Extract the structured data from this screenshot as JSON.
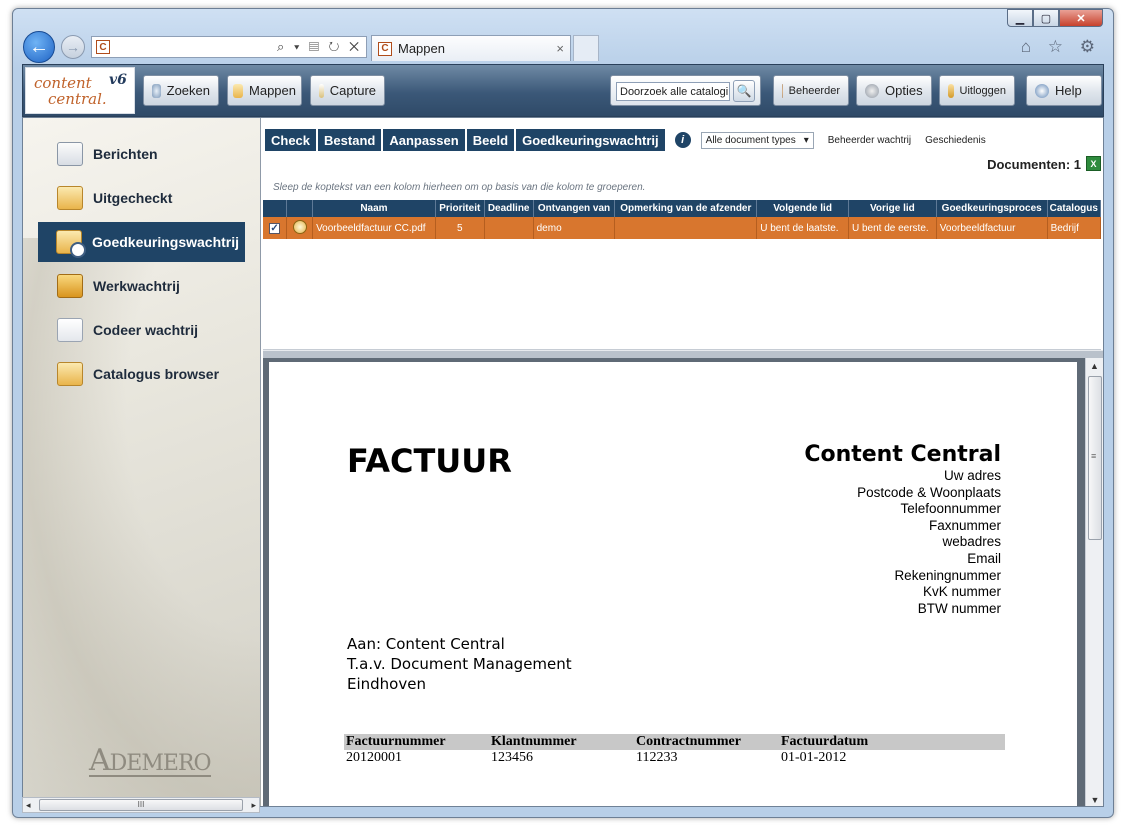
{
  "browser": {
    "address_text": "",
    "tab_title": "Mappen",
    "tab_close": "×",
    "address_icons": "⌕ ▾ ▤ ↻ ✕",
    "toolbar_icons": "⌂ ☆ ⚙",
    "favicon": "C",
    "caption": {
      "minimize": "▁",
      "maximize": "▢",
      "close": "✕"
    },
    "back_glyph": "←",
    "forward_glyph": "→"
  },
  "app": {
    "logo_line1": "content",
    "logo_line2": "central.",
    "logo_version": "v6",
    "buttons": {
      "zoeken": "Zoeken",
      "mappen": "Mappen",
      "capture": "Capture",
      "beheerder": "Beheerder",
      "opties": "Opties",
      "uitloggen": "Uitloggen",
      "help": "Help"
    },
    "search_value": "Doorzoek alle catalogi",
    "search_go": "🔍"
  },
  "sidebar": {
    "items": [
      {
        "label": "Berichten",
        "icon": "envelope-icon"
      },
      {
        "label": "Uitgecheckt",
        "icon": "folder-out-icon"
      },
      {
        "label": "Goedkeuringswachtrij",
        "icon": "approval-queue-icon",
        "active": true
      },
      {
        "label": "Werkwachtrij",
        "icon": "briefcase-icon"
      },
      {
        "label": "Codeer wachtrij",
        "icon": "edit-document-icon"
      },
      {
        "label": "Catalogus browser",
        "icon": "catalog-icon"
      }
    ],
    "brand": "ADEMERO",
    "brand_a": "A",
    "brand_rest": "DEMERO"
  },
  "menubar": {
    "tabs": [
      "Check",
      "Bestand",
      "Aanpassen",
      "Beeld",
      "Goedkeuringswachtrij"
    ],
    "info_glyph": "i",
    "doc_types": "Alle document types",
    "doc_types_arrow": "▾",
    "links": [
      "Beheerder wachtrij",
      "Geschiedenis"
    ]
  },
  "documents_count": "Documenten: 1",
  "xls_glyph": "X",
  "group_hint": "Sleep de koptekst van een kolom hierheen om op basis van die kolom te groeperen.",
  "grid": {
    "columns": [
      "Naam",
      "Prioriteit",
      "Deadline",
      "Ontvangen van",
      "Opmerking van de afzender",
      "Volgende lid",
      "Vorige lid",
      "Goedkeuringsproces",
      "Catalogus"
    ],
    "rows": [
      {
        "checked": "✓",
        "naam": "Voorbeeldfactuur CC.pdf",
        "prioriteit": "5",
        "deadline": "",
        "ontvangen_van": "demo",
        "opmerking": "",
        "volgende_lid": "U bent de laatste.",
        "vorige_lid": "U bent de eerste.",
        "proces": "Voorbeeldfactuur",
        "catalogus": "Bedrijf"
      }
    ]
  },
  "invoice": {
    "title": "FACTUUR",
    "company": "Content Central",
    "address_lines": [
      "Uw adres",
      "Postcode & Woonplaats",
      "Telefoonnummer",
      "Faxnummer",
      "webadres",
      "Email",
      "Rekeningnummer",
      "KvK nummer",
      "BTW nummer"
    ],
    "to_lines": [
      "Aan: Content Central",
      "T.a.v. Document Management",
      "Eindhoven"
    ],
    "table_headers": [
      "Factuurnummer",
      "Klantnummer",
      "Contractnummer",
      "Factuurdatum"
    ],
    "table_values": [
      "20120001",
      "123456",
      "112233",
      "01-01-2012"
    ]
  },
  "scroll": {
    "up": "▲",
    "down": "▼",
    "left": "◂",
    "right": "▸",
    "grip": "III",
    "vgrip": "≡"
  }
}
